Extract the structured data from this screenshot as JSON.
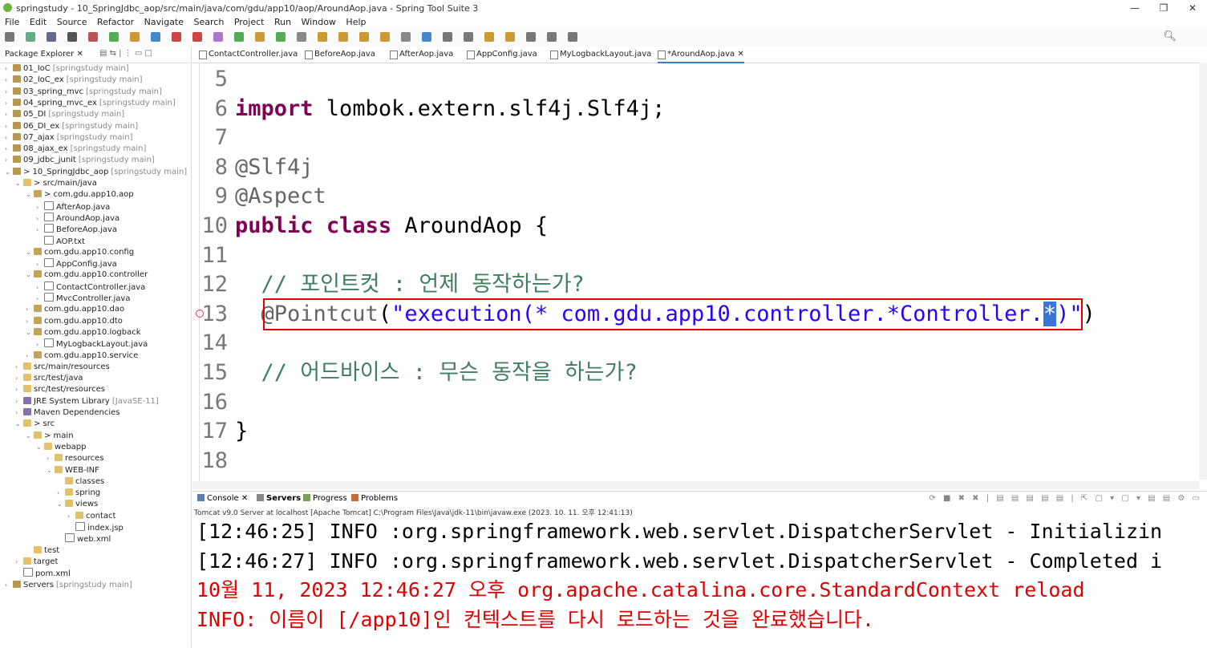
{
  "window": {
    "title": "springstudy - 10_SpringJdbc_aop/src/main/java/com/gdu/app10/aop/AroundAop.java - Spring Tool Suite 3",
    "controls": [
      "—",
      "❐",
      "✕"
    ]
  },
  "menu": [
    "File",
    "Edit",
    "Source",
    "Refactor",
    "Navigate",
    "Search",
    "Project",
    "Run",
    "Window",
    "Help"
  ],
  "package_explorer": {
    "title": "Package Explorer",
    "tree": [
      {
        "label": "01_IoC",
        "suffix": "[springstudy main]",
        "depth": 0,
        "arrow": ">",
        "icon": "proj"
      },
      {
        "label": "02_IoC_ex",
        "suffix": "[springstudy main]",
        "depth": 0,
        "arrow": ">",
        "icon": "proj"
      },
      {
        "label": "03_spring_mvc",
        "suffix": "[springstudy main]",
        "depth": 0,
        "arrow": ">",
        "icon": "proj"
      },
      {
        "label": "04_spring_mvc_ex",
        "suffix": "[springstudy main]",
        "depth": 0,
        "arrow": ">",
        "icon": "proj"
      },
      {
        "label": "05_DI",
        "suffix": "[springstudy main]",
        "depth": 0,
        "arrow": ">",
        "icon": "proj"
      },
      {
        "label": "06_DI_ex",
        "suffix": "[springstudy main]",
        "depth": 0,
        "arrow": ">",
        "icon": "proj"
      },
      {
        "label": "07_ajax",
        "suffix": "[springstudy main]",
        "depth": 0,
        "arrow": ">",
        "icon": "proj"
      },
      {
        "label": "08_ajax_ex",
        "suffix": "[springstudy main]",
        "depth": 0,
        "arrow": ">",
        "icon": "proj"
      },
      {
        "label": "09_jdbc_junit",
        "suffix": "[springstudy main]",
        "depth": 0,
        "arrow": ">",
        "icon": "proj"
      },
      {
        "label": "> 10_SpringJdbc_aop",
        "suffix": "[springstudy main]",
        "depth": 0,
        "arrow": "v",
        "icon": "proj"
      },
      {
        "label": "> src/main/java",
        "suffix": "",
        "depth": 1,
        "arrow": "v",
        "icon": "folder"
      },
      {
        "label": "> com.gdu.app10.aop",
        "suffix": "",
        "depth": 2,
        "arrow": "v",
        "icon": "pkg"
      },
      {
        "label": "AfterAop.java",
        "suffix": "",
        "depth": 3,
        "arrow": ">",
        "icon": "java"
      },
      {
        "label": "AroundAop.java",
        "suffix": "",
        "depth": 3,
        "arrow": ">",
        "icon": "java"
      },
      {
        "label": "BeforeAop.java",
        "suffix": "",
        "depth": 3,
        "arrow": ">",
        "icon": "java"
      },
      {
        "label": "AOP.txt",
        "suffix": "",
        "depth": 3,
        "arrow": "",
        "icon": "java"
      },
      {
        "label": "com.gdu.app10.config",
        "suffix": "",
        "depth": 2,
        "arrow": "v",
        "icon": "pkg"
      },
      {
        "label": "AppConfig.java",
        "suffix": "",
        "depth": 3,
        "arrow": ">",
        "icon": "java"
      },
      {
        "label": "com.gdu.app10.controller",
        "suffix": "",
        "depth": 2,
        "arrow": "v",
        "icon": "pkg"
      },
      {
        "label": "ContactController.java",
        "suffix": "",
        "depth": 3,
        "arrow": ">",
        "icon": "java"
      },
      {
        "label": "MvcController.java",
        "suffix": "",
        "depth": 3,
        "arrow": ">",
        "icon": "java"
      },
      {
        "label": "com.gdu.app10.dao",
        "suffix": "",
        "depth": 2,
        "arrow": ">",
        "icon": "pkg"
      },
      {
        "label": "com.gdu.app10.dto",
        "suffix": "",
        "depth": 2,
        "arrow": ">",
        "icon": "pkg"
      },
      {
        "label": "com.gdu.app10.logback",
        "suffix": "",
        "depth": 2,
        "arrow": "v",
        "icon": "pkg"
      },
      {
        "label": "MyLogbackLayout.java",
        "suffix": "",
        "depth": 3,
        "arrow": ">",
        "icon": "java"
      },
      {
        "label": "com.gdu.app10.service",
        "suffix": "",
        "depth": 2,
        "arrow": ">",
        "icon": "pkg"
      },
      {
        "label": "src/main/resources",
        "suffix": "",
        "depth": 1,
        "arrow": ">",
        "icon": "folder"
      },
      {
        "label": "src/test/java",
        "suffix": "",
        "depth": 1,
        "arrow": ">",
        "icon": "folder"
      },
      {
        "label": "src/test/resources",
        "suffix": "",
        "depth": 1,
        "arrow": ">",
        "icon": "folder"
      },
      {
        "label": "JRE System Library",
        "suffix": "[JavaSE-11]",
        "depth": 1,
        "arrow": ">",
        "icon": "lib"
      },
      {
        "label": "Maven Dependencies",
        "suffix": "",
        "depth": 1,
        "arrow": ">",
        "icon": "lib"
      },
      {
        "label": "> src",
        "suffix": "",
        "depth": 1,
        "arrow": "v",
        "icon": "folder"
      },
      {
        "label": "> main",
        "suffix": "",
        "depth": 2,
        "arrow": "v",
        "icon": "folder"
      },
      {
        "label": "webapp",
        "suffix": "",
        "depth": 3,
        "arrow": "v",
        "icon": "folder"
      },
      {
        "label": "resources",
        "suffix": "",
        "depth": 4,
        "arrow": ">",
        "icon": "folder"
      },
      {
        "label": "WEB-INF",
        "suffix": "",
        "depth": 4,
        "arrow": "v",
        "icon": "folder"
      },
      {
        "label": "classes",
        "suffix": "",
        "depth": 5,
        "arrow": "",
        "icon": "folder"
      },
      {
        "label": "spring",
        "suffix": "",
        "depth": 5,
        "arrow": ">",
        "icon": "folder"
      },
      {
        "label": "views",
        "suffix": "",
        "depth": 5,
        "arrow": "v",
        "icon": "folder"
      },
      {
        "label": "contact",
        "suffix": "",
        "depth": 6,
        "arrow": ">",
        "icon": "folder"
      },
      {
        "label": "index.jsp",
        "suffix": "",
        "depth": 6,
        "arrow": "",
        "icon": "java"
      },
      {
        "label": "web.xml",
        "suffix": "",
        "depth": 5,
        "arrow": "",
        "icon": "java"
      },
      {
        "label": "test",
        "suffix": "",
        "depth": 2,
        "arrow": "",
        "icon": "folder"
      },
      {
        "label": "target",
        "suffix": "",
        "depth": 1,
        "arrow": ">",
        "icon": "folder"
      },
      {
        "label": "pom.xml",
        "suffix": "",
        "depth": 1,
        "arrow": "",
        "icon": "java"
      },
      {
        "label": "Servers",
        "suffix": "[springstudy main]",
        "depth": 0,
        "arrow": ">",
        "icon": "proj"
      }
    ]
  },
  "editor": {
    "tabs": [
      {
        "label": "ContactController.java",
        "active": false
      },
      {
        "label": "BeforeAop.java",
        "active": false
      },
      {
        "label": "AfterAop.java",
        "active": false
      },
      {
        "label": "AppConfig.java",
        "active": false
      },
      {
        "label": "MyLogbackLayout.java",
        "active": false
      },
      {
        "label": "*AroundAop.java",
        "active": true
      }
    ],
    "lines": [
      {
        "n": "5",
        "text": ""
      },
      {
        "n": "6",
        "text": "import lombok.extern.slf4j.Slf4j;"
      },
      {
        "n": "7",
        "text": ""
      },
      {
        "n": "8",
        "text": "@Slf4j"
      },
      {
        "n": "9",
        "text": "@Aspect"
      },
      {
        "n": "10",
        "text": "public class AroundAop {"
      },
      {
        "n": "11",
        "text": ""
      },
      {
        "n": "12",
        "text": "  // 포인트컷 : 언제 동작하는가?"
      },
      {
        "n": "13",
        "text": "  @Pointcut(\"execution(* com.gdu.app10.controller.*Controller.*)\")"
      },
      {
        "n": "14",
        "text": ""
      },
      {
        "n": "15",
        "text": "  // 어드바이스 : 무슨 동작을 하는가?"
      },
      {
        "n": "16",
        "text": ""
      },
      {
        "n": "17",
        "text": "}"
      },
      {
        "n": "18",
        "text": ""
      }
    ]
  },
  "console": {
    "tabs": [
      "Console",
      "Servers",
      "Progress",
      "Problems"
    ],
    "server_info": "Tomcat v9.0 Server at localhost [Apache Tomcat] C:\\Program Files\\Java\\jdk-11\\bin\\javaw.exe  (2023. 10. 11. 오후 12:41:13)",
    "lines": [
      {
        "text": "[12:46:25] INFO :org.springframework.web.servlet.DispatcherServlet - Initializin",
        "color": "black"
      },
      {
        "text": "[12:46:27] INFO :org.springframework.web.servlet.DispatcherServlet - Completed i",
        "color": "black"
      },
      {
        "text": "10월 11, 2023 12:46:27 오후 org.apache.catalina.core.StandardContext reload",
        "color": "red"
      },
      {
        "text": "INFO: 이름이 [/app10]인 컨텍스트를 다시 로드하는 것을 완료했습니다.",
        "color": "red"
      }
    ]
  },
  "search_icon": "search-icon"
}
